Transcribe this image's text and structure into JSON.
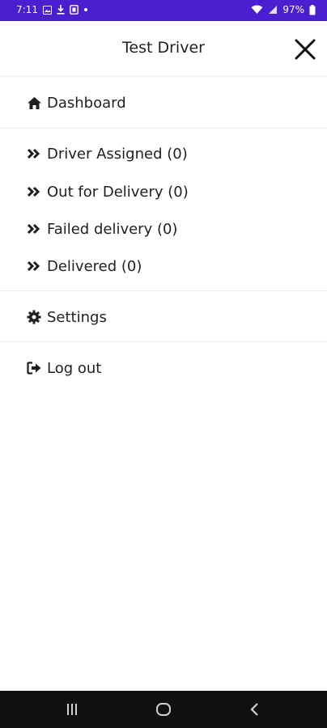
{
  "status_bar": {
    "time": "7:11",
    "battery": "97%"
  },
  "header": {
    "title": "Test Driver"
  },
  "menu": {
    "dashboard": "Dashboard",
    "orders": [
      "Driver Assigned (0)",
      "Out for Delivery (0)",
      "Failed delivery (0)",
      "Delivered (0)"
    ],
    "settings": "Settings",
    "logout": "Log out"
  },
  "colors": {
    "status_bar": "#4a1fd0",
    "nav_bar": "#111111",
    "text": "#1f1f1f"
  },
  "icons": {
    "dashboard": "home-icon",
    "orders": "double-chevron-right-icon",
    "settings": "gear-icon",
    "logout": "sign-out-icon"
  }
}
